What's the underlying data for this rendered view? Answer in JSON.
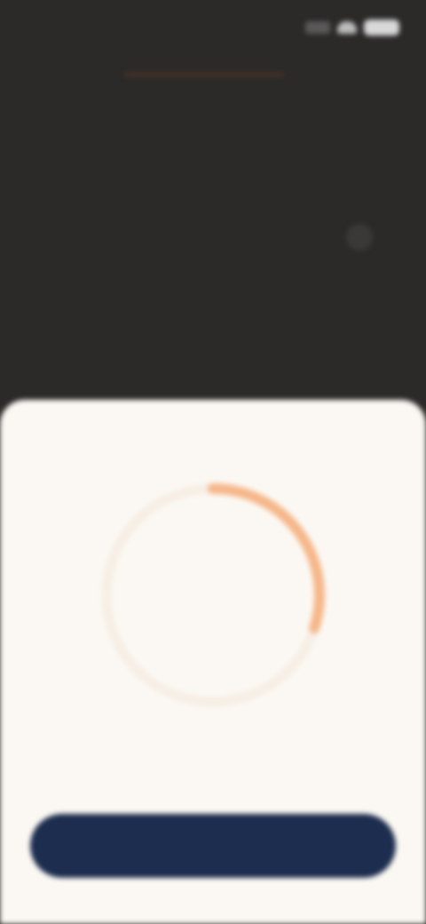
{
  "status": {
    "time": "",
    "icons": [
      "signal-icon",
      "wifi-icon",
      "battery-icon"
    ]
  },
  "section": {
    "title": ""
  },
  "options": [
    {
      "label": "",
      "selected": true
    },
    {
      "label": "",
      "selected": false
    },
    {
      "label": "",
      "selected": false
    },
    {
      "label": "",
      "selected": false
    }
  ],
  "gauge": {
    "caption": "",
    "value": "",
    "fill_fraction": 0.3,
    "accent": "#f6b78a",
    "track": "#fbf8f3"
  },
  "legend": {
    "value": "",
    "label": ""
  },
  "cta": {
    "label": ""
  },
  "colors": {
    "overlay": "#2b2a29",
    "sheet": "#fbf8f3",
    "button": "#1d2d4f",
    "accent": "#f6b78a"
  }
}
